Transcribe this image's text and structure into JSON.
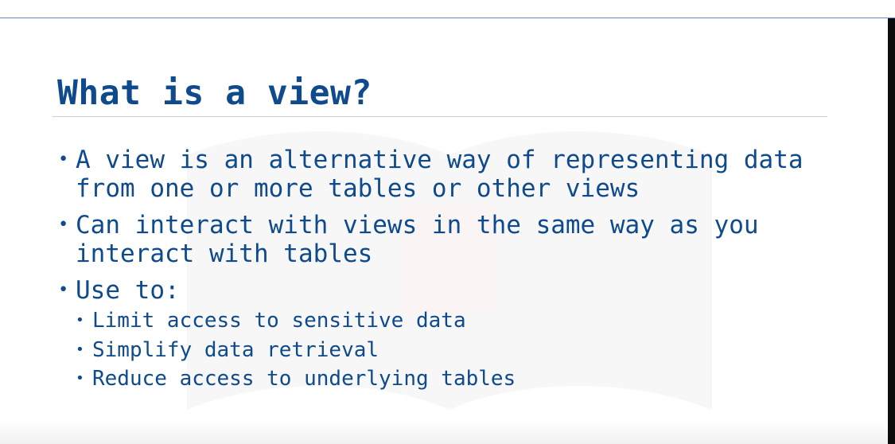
{
  "slide": {
    "title": "What is a view?",
    "bullets": [
      {
        "text": "A view is an alternative way of representing data from one or more tables or other views"
      },
      {
        "text": "Can interact with views in the same way as you interact with tables"
      },
      {
        "text": "Use to:"
      }
    ],
    "sub_bullets": [
      {
        "text": "Limit access to sensitive data"
      },
      {
        "text": "Simplify data retrieval"
      },
      {
        "text": "Reduce access to underlying tables"
      }
    ],
    "bullet_symbol": "•"
  },
  "colors": {
    "text": "#0e4a8c",
    "rule": "#c9cfd8",
    "top_rule": "#5b8ed6"
  }
}
